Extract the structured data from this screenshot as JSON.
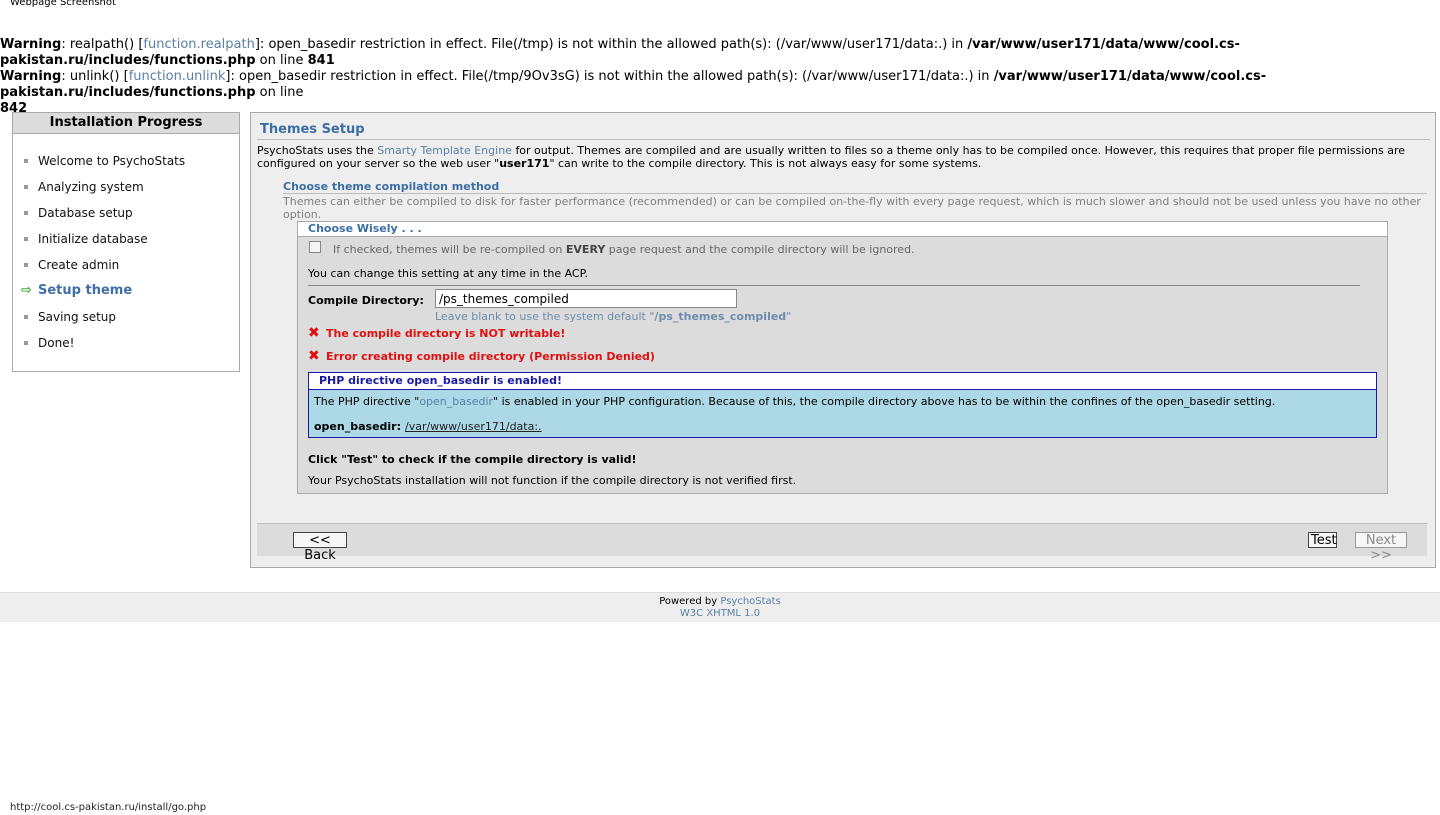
{
  "window_title": "Webpage Screenshot",
  "warnings": [
    {
      "label": "Warning",
      "func": "realpath()",
      "link": "function.realpath",
      "message": "open_basedir restriction in effect. File(/tmp) is not within the allowed path(s): (/var/www/user171/data:.) in",
      "file": "/var/www/user171/data/www/cool.cs-pakistan.ru/includes/functions.php",
      "on_line": "on line",
      "line": "841"
    },
    {
      "label": "Warning",
      "func": "unlink()",
      "link": "function.unlink",
      "message": "open_basedir restriction in effect. File(/tmp/9Ov3sG) is not within the allowed path(s): (/var/www/user171/data:.) in",
      "file": "/var/www/user171/data/www/cool.cs-pakistan.ru/includes/functions.php",
      "on_line": "on line",
      "line": "842"
    }
  ],
  "sidebar": {
    "title": "Installation Progress",
    "steps": [
      {
        "label": "Welcome to PsychoStats"
      },
      {
        "label": "Analyzing system"
      },
      {
        "label": "Database setup"
      },
      {
        "label": "Initialize database"
      },
      {
        "label": "Create admin"
      },
      {
        "label": "Setup theme"
      },
      {
        "label": "Saving setup"
      },
      {
        "label": "Done!"
      }
    ],
    "current_index": 5
  },
  "main": {
    "title": "Themes Setup",
    "intro": {
      "pre": "PsychoStats uses the",
      "link": "Smarty Template Engine",
      "mid": "for output. Themes are compiled and are usually written to files so a theme only has to be compiled once. However, this requires that proper file permissions are configured on your server so the web user \"",
      "user": "user171",
      "post": "\" can write to the compile directory. This is not always easy for some systems."
    },
    "section_title": "Choose theme compilation method",
    "section_desc": "Themes can either be compiled to disk for faster performance (recommended) or can be compiled on-the-fly with every page request, which is much slower and should not be used unless you have no other option.",
    "wisely": {
      "title": "Choose Wisely . . .",
      "recompile_pre": "If checked, themes will be re-compiled on",
      "recompile_bold": "EVERY",
      "recompile_post": "page request and the compile directory will be ignored.",
      "recompile_checked": false,
      "change_note": "You can change this setting at any time in the ACP.",
      "compile_dir_label": "Compile Directory:",
      "compile_dir_value": "/ps_themes_compiled",
      "hint_pre": "Leave blank to use the system default \"",
      "hint_default": "/ps_themes_compiled",
      "hint_post": "\"",
      "error1": "The compile directory is NOT writable!",
      "error2": "Error creating compile directory (Permission Denied)",
      "php": {
        "title": "PHP directive open_basedir is enabled!",
        "text_pre": "The PHP directive \"",
        "text_link": "open_basedir",
        "text_post": "\" is enabled in your PHP configuration. Because of this, the compile directory above has to be within the confines of the open_basedir setting.",
        "obd_label": "open_basedir:",
        "obd_value": "/var/www/user171/data:."
      },
      "test_note": "Click \"Test\" to check if the compile directory is valid!",
      "verify_note": "Your PsychoStats installation will not function if the compile directory is not verified first."
    },
    "buttons": {
      "back": "<< Back",
      "test": "Test",
      "next": "Next >>"
    }
  },
  "footer": {
    "powered": "Powered by",
    "link": "PsychoStats",
    "xhtml": "W3C XHTML 1.0"
  },
  "status_bar": "http://cool.cs-pakistan.ru/install/go.php",
  "colors": {
    "accent": "#3b6ea5",
    "error": "#e01010",
    "info_bg": "#add8e6",
    "info_border": "#1a1aa6"
  }
}
